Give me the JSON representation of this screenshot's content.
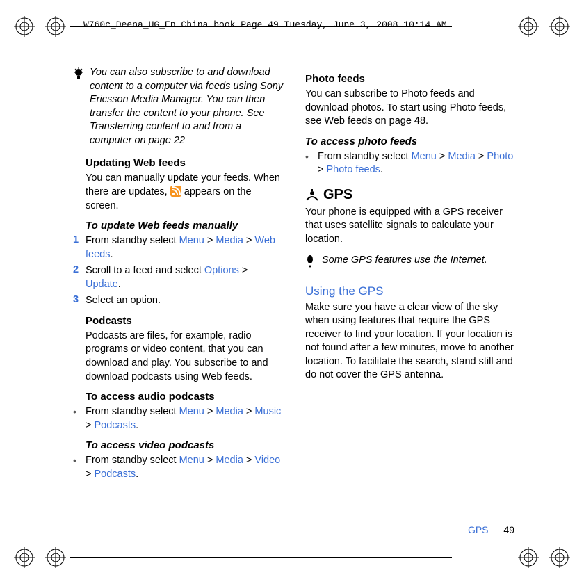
{
  "header": {
    "stamp": "W760c_Deena_UG_En China.book  Page 49  Tuesday, June 3, 2008  10:14 AM"
  },
  "left": {
    "tip": "You can also subscribe to and download content to a computer via feeds using Sony Ericsson Media Manager. You can then transfer the content to your phone. See Transferring content to and from a computer on page 22",
    "updating_head": "Updating Web feeds",
    "updating_body_a": "You can manually update your feeds. When there are updates, ",
    "updating_body_b": " appears on the screen.",
    "manual_head": "To update Web feeds manually",
    "step1_a": "From standby select ",
    "step1_menu": "Menu",
    "step1_gt1": " > ",
    "step1_media": "Media",
    "step1_gt2": " > ",
    "step1_web": "Web feeds",
    "step1_dot": ".",
    "step2_a": "Scroll to a feed and select ",
    "step2_opt": "Options",
    "step2_gt": " > ",
    "step2_upd": "Update",
    "step2_dot": ".",
    "step3": "Select an option.",
    "podcasts_head": "Podcasts",
    "podcasts_body": "Podcasts are files, for example, radio programs or video content, that you can download and play. You subscribe to and download podcasts using Web feeds.",
    "audio_head": "To access audio podcasts",
    "audio_a": "From standby select ",
    "audio_menu": "Menu",
    "audio_gt1": " > ",
    "audio_media": "Media",
    "audio_gt2": " > ",
    "audio_music": "Music",
    "audio_gt3": " > ",
    "audio_pod": "Podcasts",
    "audio_dot": ".",
    "video_head": "To access video podcasts",
    "video_a": "From standby select ",
    "video_menu": "Menu",
    "video_gt1": " > ",
    "video_media": "Media",
    "video_gt2": " > ",
    "video_video": "Video",
    "video_gt3": " > ",
    "video_pod": "Podcasts",
    "video_dot": "."
  },
  "right": {
    "photo_head": "Photo feeds",
    "photo_body": "You can subscribe to Photo feeds and download photos. To start using Photo feeds, see Web feeds on page 48.",
    "photo_access_head": "To access photo feeds",
    "photo_a": "From standby select ",
    "photo_menu": "Menu",
    "photo_gt1": " > ",
    "photo_media": "Media",
    "photo_gt2": " > ",
    "photo_photo": "Photo",
    "photo_gt3": " > ",
    "photo_feeds": "Photo feeds",
    "photo_dot": ".",
    "gps_title": "GPS",
    "gps_body": "Your phone is equipped with a GPS receiver that uses satellite signals to calculate your location.",
    "gps_tip": "Some GPS features use the Internet.",
    "using_head": "Using the GPS",
    "using_body": "Make sure you have a clear view of the sky when using features that require the GPS receiver to find your location. If your location is not found after a few minutes, move to another location. To facilitate the search, stand still and do not cover the GPS antenna."
  },
  "footer": {
    "section": "GPS",
    "page": "49"
  }
}
